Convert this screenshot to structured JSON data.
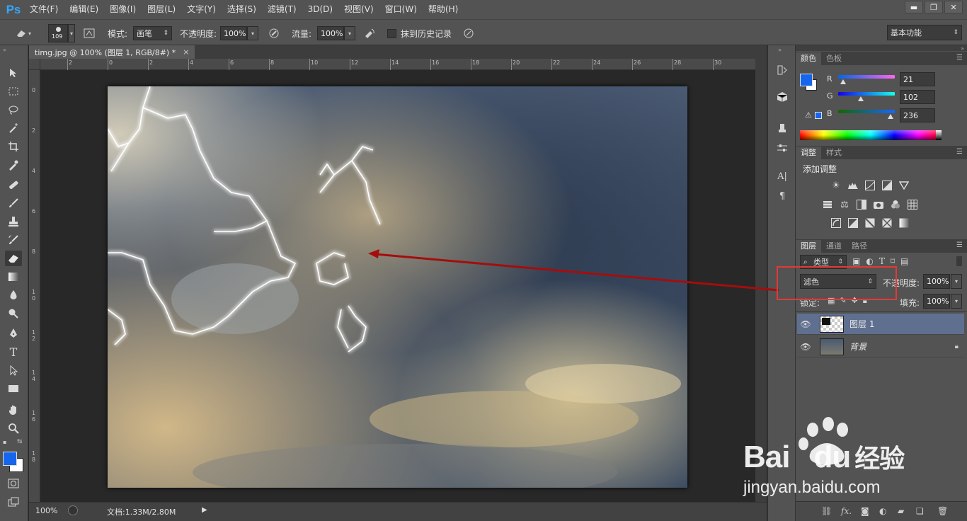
{
  "app": {
    "logo": "Ps"
  },
  "menu": [
    "文件(F)",
    "编辑(E)",
    "图像(I)",
    "图层(L)",
    "文字(Y)",
    "选择(S)",
    "滤镜(T)",
    "3D(D)",
    "视图(V)",
    "窗口(W)",
    "帮助(H)"
  ],
  "window_controls": {
    "minimize": "▬",
    "restore": "❐",
    "close": "✕"
  },
  "options": {
    "brush_size": "109",
    "mode_label": "模式:",
    "mode_value": "画笔",
    "opacity_label": "不透明度:",
    "opacity_value": "100%",
    "flow_label": "流量:",
    "flow_value": "100%",
    "erase_history_label": "抹到历史记录",
    "workspace": "基本功能"
  },
  "document": {
    "tab_title": "timg.jpg @ 100% (图层 1, RGB/8#) *",
    "close": "×",
    "ruler_top": [
      "2",
      "0",
      "2",
      "4",
      "6",
      "8",
      "10",
      "12",
      "14",
      "16",
      "18",
      "20",
      "22",
      "24",
      "26",
      "28",
      "30"
    ],
    "ruler_left": [
      "0",
      "2",
      "4",
      "6",
      "8",
      "1\n0",
      "1\n2",
      "1\n4",
      "1\n6",
      "1\n8"
    ]
  },
  "status": {
    "zoom": "100%",
    "doc_info": "文档:1.33M/2.80M"
  },
  "color_panel": {
    "tabs": [
      "颜色",
      "色板"
    ],
    "r_label": "R",
    "g_label": "G",
    "b_label": "B",
    "r": "21",
    "g": "102",
    "b": "236",
    "r_fraction": 0.082,
    "g_fraction": 0.4,
    "b_fraction": 0.925,
    "foreground": "#1566ec",
    "background": "#ffffff"
  },
  "adjust_panel": {
    "tabs": [
      "调整",
      "样式"
    ],
    "title": "添加调整"
  },
  "layers_panel": {
    "tabs": [
      "图层",
      "通道",
      "路径"
    ],
    "filter_label": "类型",
    "blend_mode": "滤色",
    "opacity_label": "不透明度:",
    "opacity_value": "100%",
    "lock_label": "锁定:",
    "fill_label": "填充:",
    "fill_value": "100%",
    "layers": [
      {
        "name": "图层 1",
        "selected": true
      },
      {
        "name": "背景",
        "selected": false,
        "locked": true
      }
    ]
  },
  "watermark": {
    "brand_a": "Bai",
    "brand_b": "du",
    "brand_cn": "经验",
    "url": "jingyan.baidu.com"
  },
  "colors": {
    "annotation_red": "#e53935",
    "arrow": "#a50d0d",
    "selection": "#5f6f8f"
  }
}
